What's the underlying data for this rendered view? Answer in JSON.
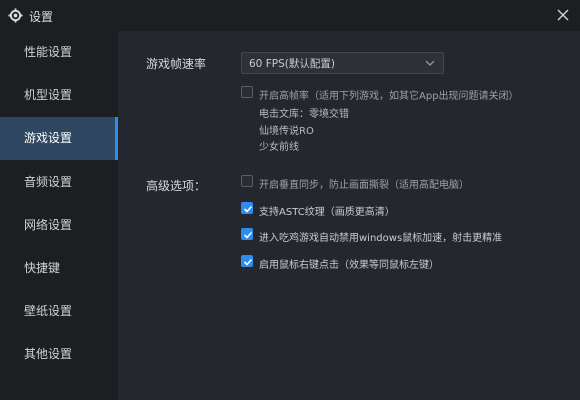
{
  "window": {
    "title": "设置",
    "icons": {
      "settings": "gear-icon",
      "close": "close-icon"
    }
  },
  "sidebar": {
    "items": [
      {
        "label": "性能设置",
        "active": false
      },
      {
        "label": "机型设置",
        "active": false
      },
      {
        "label": "游戏设置",
        "active": true
      },
      {
        "label": "音频设置",
        "active": false
      },
      {
        "label": "网络设置",
        "active": false
      },
      {
        "label": "快捷键",
        "active": false
      },
      {
        "label": "壁纸设置",
        "active": false
      },
      {
        "label": "其他设置",
        "active": false
      }
    ]
  },
  "game": {
    "fps_label": "游戏帧速率",
    "fps_value": "60 FPS(默认配置)",
    "high_fps": {
      "checked": false,
      "label": "开启高帧率（适用下列游戏，如其它App出现问题请关闭）",
      "games": [
        "电击文库：零境交错",
        "仙境传说RO",
        "少女前线"
      ]
    },
    "advanced_label": "高级选项：",
    "options": [
      {
        "label": "开启垂直同步，防止画面撕裂（适用高配电脑）",
        "checked": false
      },
      {
        "label": "支持ASTC纹理（画质更高清）",
        "checked": true
      },
      {
        "label": "进入吃鸡游戏自动禁用windows鼠标加速，射击更精准",
        "checked": true
      },
      {
        "label": "启用鼠标右键点击（效果等同鼠标左键）",
        "checked": true
      }
    ]
  },
  "colors": {
    "accent": "#2d8cf0",
    "background": "#24272d",
    "sidebar": "#1c1e22",
    "active_item": "#2f4760"
  }
}
